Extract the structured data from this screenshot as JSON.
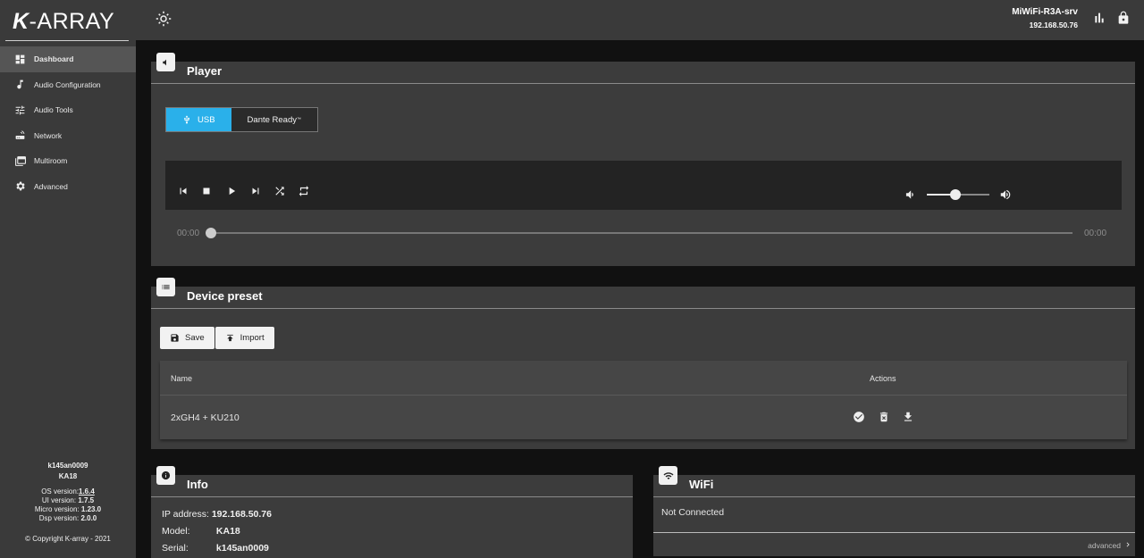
{
  "brand": {
    "logo_k": "K",
    "logo_rest": "-ARRAY"
  },
  "sidebar": {
    "items": [
      {
        "label": "Dashboard",
        "icon": "dashboard-icon",
        "active": true
      },
      {
        "label": "Audio Configuration",
        "icon": "music-note-icon"
      },
      {
        "label": "Audio Tools",
        "icon": "sliders-icon"
      },
      {
        "label": "Network",
        "icon": "router-icon"
      },
      {
        "label": "Multiroom",
        "icon": "multiroom-icon"
      },
      {
        "label": "Advanced",
        "icon": "gear-icon"
      }
    ],
    "device_id": "k145an0009",
    "device_model": "KA18",
    "os_label": "OS version:",
    "os_version": "1.6.4",
    "ui_label": "UI version:",
    "ui_version": "1.7.5",
    "micro_label": "Micro version:",
    "micro_version": "1.23.0",
    "dsp_label": "Dsp version:",
    "dsp_version": "2.0.0",
    "copyright": "© Copyright K-array - 2021"
  },
  "topbar": {
    "theme_icon": "sun-icon",
    "hostname": "MiWiFi-R3A-srv",
    "ip": "192.168.50.76",
    "stats_icon": "bar-chart-icon",
    "lock_icon": "lock-icon"
  },
  "player": {
    "title": "Player",
    "sources": [
      {
        "label": "USB",
        "active": true
      },
      {
        "label": "Dante Ready",
        "sup": "™"
      }
    ],
    "time_start": "00:00",
    "time_end": "00:00",
    "volume_level": 0.45,
    "progress": 0.0
  },
  "preset": {
    "title": "Device preset",
    "save_label": "Save",
    "import_label": "Import",
    "col_name": "Name",
    "col_actions": "Actions",
    "rows": [
      {
        "name": "2xGH4 + KU210"
      }
    ]
  },
  "info": {
    "title": "Info",
    "ip_label": "IP address:",
    "ip_value": "192.168.50.76",
    "model_label": "Model:",
    "model_value": "KA18",
    "serial_label": "Serial:",
    "serial_value": "k145an0009"
  },
  "wifi": {
    "title": "WiFi",
    "status": "Not Connected",
    "advanced_label": "advanced"
  }
}
